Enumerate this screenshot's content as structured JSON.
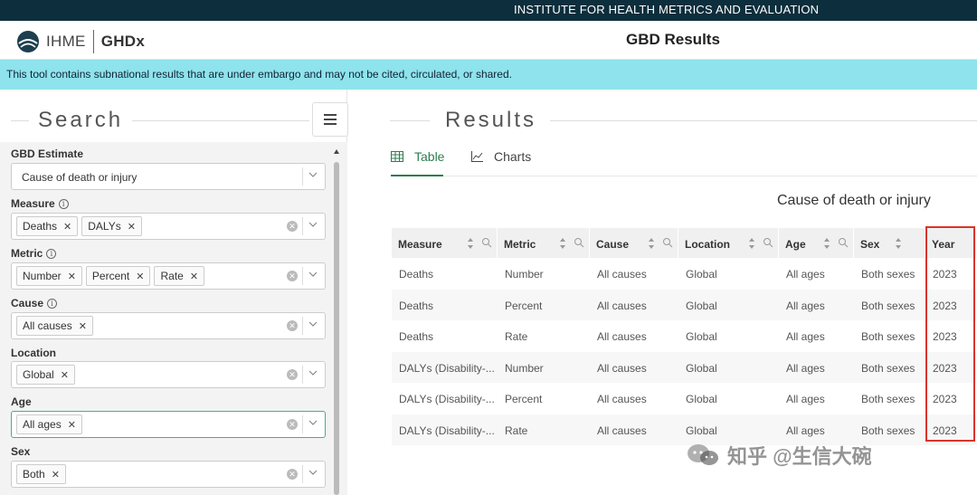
{
  "top_banner": "INSTITUTE FOR HEALTH METRICS AND EVALUATION",
  "header": {
    "logo_ihme": "IHME",
    "logo_ghdx": "GHDx",
    "title": "GBD Results"
  },
  "embargo_notice": "This tool contains subnational results that are under embargo and may not be cited, circulated, or shared.",
  "search": {
    "title": "Search",
    "filters": [
      {
        "label": "GBD Estimate",
        "value": "Cause of death or injury"
      },
      {
        "label": "Measure",
        "chips": [
          "Deaths",
          "DALYs"
        ]
      },
      {
        "label": "Metric",
        "chips": [
          "Number",
          "Percent",
          "Rate"
        ]
      },
      {
        "label": "Cause",
        "chips": [
          "All causes"
        ]
      },
      {
        "label": "Location",
        "chips": [
          "Global"
        ]
      },
      {
        "label": "Age",
        "chips": [
          "All ages"
        ]
      },
      {
        "label": "Sex",
        "chips": [
          "Both"
        ]
      }
    ]
  },
  "results": {
    "title": "Results",
    "tabs": {
      "table": "Table",
      "charts": "Charts"
    },
    "subtitle": "Cause of death or injury",
    "columns": [
      "Measure",
      "Metric",
      "Cause",
      "Location",
      "Age",
      "Sex",
      "Year"
    ],
    "rows": [
      [
        "Deaths",
        "Number",
        "All causes",
        "Global",
        "All ages",
        "Both sexes",
        "2023"
      ],
      [
        "Deaths",
        "Percent",
        "All causes",
        "Global",
        "All ages",
        "Both sexes",
        "2023"
      ],
      [
        "Deaths",
        "Rate",
        "All causes",
        "Global",
        "All ages",
        "Both sexes",
        "2023"
      ],
      [
        "DALYs (Disability-...",
        "Number",
        "All causes",
        "Global",
        "All ages",
        "Both sexes",
        "2023"
      ],
      [
        "DALYs (Disability-...",
        "Percent",
        "All causes",
        "Global",
        "All ages",
        "Both sexes",
        "2023"
      ],
      [
        "DALYs (Disability-...",
        "Rate",
        "All causes",
        "Global",
        "All ages",
        "Both sexes",
        "2023"
      ]
    ]
  },
  "highlight_color": "#d9342b",
  "accent_color": "#2e7d4f",
  "watermark": "知乎 @生信大碗"
}
